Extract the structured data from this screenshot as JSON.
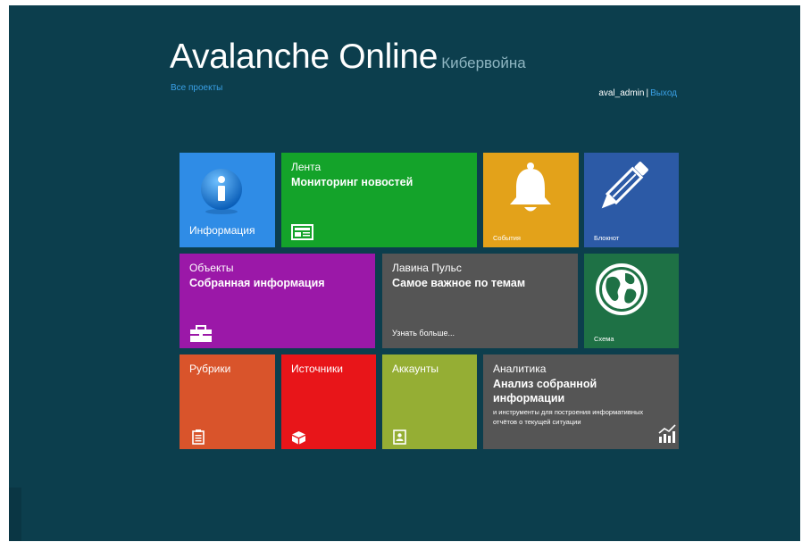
{
  "header": {
    "title": "Avalanche Online",
    "subtitle": "Кибервойна",
    "all_projects": "Все проекты"
  },
  "user": {
    "name": "aval_admin",
    "separator": "|",
    "logout": "Выход"
  },
  "tiles": {
    "info": {
      "label": "Информация",
      "color": "#2f8ce6",
      "icon": "info-icon"
    },
    "feed": {
      "title": "Лента",
      "subtitle": "Мониторинг новостей",
      "color": "#14a32a",
      "icon": "newspaper-icon"
    },
    "events": {
      "label": "События",
      "color": "#e3a21a",
      "icon": "bell-icon"
    },
    "notepad": {
      "label": "Блокнот",
      "color": "#2c5aa6",
      "icon": "pencil-icon"
    },
    "objects": {
      "title": "Объекты",
      "subtitle": "Собранная информация",
      "color": "#9b18a8",
      "icon": "briefcase-icon"
    },
    "pulse": {
      "title": "Лавина Пульс",
      "subtitle": "Самое важное по темам",
      "more": "Узнать больше...",
      "color": "#555555"
    },
    "scheme": {
      "label": "Схема",
      "color": "#1e7145",
      "icon": "globe-icon"
    },
    "rubrics": {
      "title": "Рубрики",
      "color": "#d9542b",
      "icon": "clipboard-icon"
    },
    "sources": {
      "title": "Источники",
      "color": "#e81519",
      "icon": "box-icon"
    },
    "accounts": {
      "title": "Аккаунты",
      "color": "#95ae34",
      "icon": "contact-book-icon"
    },
    "analytics": {
      "title": "Аналитика",
      "subtitle_line1": "Анализ собранной",
      "subtitle_line2": "информации",
      "desc_line1": "и инструменты для построения информативных",
      "desc_line2": "отчётов о текущей ситуации",
      "color": "#555555",
      "icon": "bar-chart-icon"
    }
  }
}
